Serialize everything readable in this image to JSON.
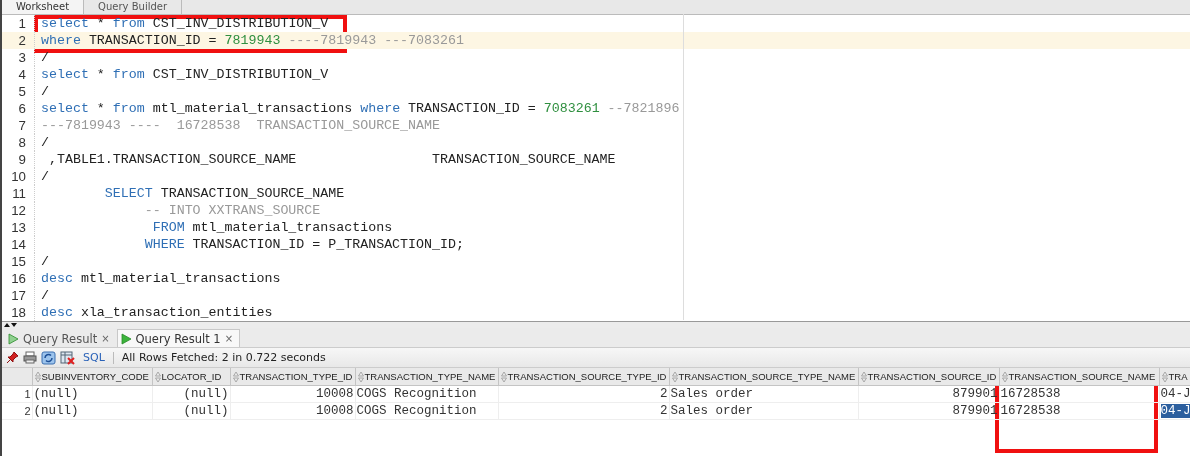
{
  "top_tabs": [
    {
      "label": "Worksheet",
      "selected": true
    },
    {
      "label": "Query Builder",
      "selected": false
    }
  ],
  "editor": {
    "lines": [
      {
        "number": "1",
        "tokens": [
          {
            "kind": "kw",
            "text": "select"
          },
          {
            "kind": "plain",
            "text": " * "
          },
          {
            "kind": "kw",
            "text": "from"
          },
          {
            "kind": "plain",
            "text": " CST_INV_DISTRIBUTION_V"
          }
        ]
      },
      {
        "number": "2",
        "current": true,
        "tokens": [
          {
            "kind": "kw",
            "text": "where"
          },
          {
            "kind": "plain",
            "text": " TRANSACTION_ID = "
          },
          {
            "kind": "num",
            "text": "7819943"
          },
          {
            "kind": "comment",
            "text": " ----7819943 ---7083261"
          }
        ]
      },
      {
        "number": "3",
        "tokens": [
          {
            "kind": "plain",
            "text": "/"
          }
        ]
      },
      {
        "number": "4",
        "tokens": [
          {
            "kind": "kw",
            "text": "select"
          },
          {
            "kind": "plain",
            "text": " * "
          },
          {
            "kind": "kw",
            "text": "from"
          },
          {
            "kind": "plain",
            "text": " CST_INV_DISTRIBUTION_V"
          }
        ]
      },
      {
        "number": "5",
        "tokens": [
          {
            "kind": "plain",
            "text": "/"
          }
        ]
      },
      {
        "number": "6",
        "tokens": [
          {
            "kind": "kw",
            "text": "select"
          },
          {
            "kind": "plain",
            "text": " * "
          },
          {
            "kind": "kw",
            "text": "from"
          },
          {
            "kind": "plain",
            "text": " mtl_material_transactions "
          },
          {
            "kind": "kw",
            "text": "where"
          },
          {
            "kind": "plain",
            "text": " TRANSACTION_ID = "
          },
          {
            "kind": "num",
            "text": "7083261"
          },
          {
            "kind": "comment",
            "text": " --7821896"
          }
        ]
      },
      {
        "number": "7",
        "tokens": [
          {
            "kind": "comment",
            "text": "---7819943 ----  16728538  TRANSACTION_SOURCE_NAME"
          }
        ]
      },
      {
        "number": "8",
        "tokens": [
          {
            "kind": "plain",
            "text": "/"
          }
        ]
      },
      {
        "number": "9",
        "tokens": [
          {
            "kind": "plain",
            "text": " ,TABLE1.TRANSACTION_SOURCE_NAME                 TRANSACTION_SOURCE_NAME"
          }
        ]
      },
      {
        "number": "10",
        "tokens": [
          {
            "kind": "plain",
            "text": "/"
          }
        ]
      },
      {
        "number": "11",
        "tokens": [
          {
            "kind": "kw",
            "text": "        SELECT"
          },
          {
            "kind": "plain",
            "text": " TRANSACTION_SOURCE_NAME"
          }
        ]
      },
      {
        "number": "12",
        "tokens": [
          {
            "kind": "comment",
            "text": "             -- INTO XXTRANS_SOURCE"
          }
        ]
      },
      {
        "number": "13",
        "tokens": [
          {
            "kind": "kw",
            "text": "              FROM"
          },
          {
            "kind": "plain",
            "text": " mtl_material_transactions"
          }
        ]
      },
      {
        "number": "14",
        "tokens": [
          {
            "kind": "kw",
            "text": "             WHERE"
          },
          {
            "kind": "plain",
            "text": " TRANSACTION_ID = P_TRANSACTION_ID;"
          }
        ]
      },
      {
        "number": "15",
        "tokens": [
          {
            "kind": "plain",
            "text": "/"
          }
        ]
      },
      {
        "number": "16",
        "tokens": [
          {
            "kind": "kw",
            "text": "desc"
          },
          {
            "kind": "plain",
            "text": " mtl_material_transactions"
          }
        ]
      },
      {
        "number": "17",
        "tokens": [
          {
            "kind": "plain",
            "text": "/"
          }
        ]
      },
      {
        "number": "18",
        "tokens": [
          {
            "kind": "kw",
            "text": "desc"
          },
          {
            "kind": "plain",
            "text": " xla_transaction_entities"
          }
        ]
      }
    ]
  },
  "result_tabs": [
    {
      "label": "Query Result",
      "close": "×",
      "selected": false
    },
    {
      "label": "Query Result 1",
      "close": "×",
      "selected": true
    }
  ],
  "toolbar": {
    "sql_link": "SQL",
    "status": "All Rows Fetched: 2 in 0.722 seconds"
  },
  "grid": {
    "columns": [
      {
        "label": "SUBINVENTORY_CODE",
        "kind": "text"
      },
      {
        "label": "LOCATOR_ID",
        "kind": "number"
      },
      {
        "label": "TRANSACTION_TYPE_ID",
        "kind": "number"
      },
      {
        "label": "TRANSACTION_TYPE_NAME",
        "kind": "text"
      },
      {
        "label": "TRANSACTION_SOURCE_TYPE_ID",
        "kind": "number"
      },
      {
        "label": "TRANSACTION_SOURCE_TYPE_NAME",
        "kind": "text"
      },
      {
        "label": "TRANSACTION_SOURCE_ID",
        "kind": "number"
      },
      {
        "label": "TRANSACTION_SOURCE_NAME",
        "kind": "text"
      },
      {
        "label": "TRA",
        "kind": "text"
      }
    ],
    "rows": [
      {
        "number": "1",
        "cells": [
          {
            "text": "(null)",
            "selected": false
          },
          {
            "text": "(null)",
            "selected": false
          },
          {
            "text": "10008",
            "selected": false
          },
          {
            "text": "COGS Recognition",
            "selected": false
          },
          {
            "text": "2",
            "selected": false
          },
          {
            "text": "Sales order",
            "selected": false
          },
          {
            "text": "879901",
            "selected": false
          },
          {
            "text": "16728538",
            "selected": false
          },
          {
            "text": "04-J",
            "selected": false
          }
        ]
      },
      {
        "number": "2",
        "cells": [
          {
            "text": "(null)",
            "selected": false
          },
          {
            "text": "(null)",
            "selected": false
          },
          {
            "text": "10008",
            "selected": false
          },
          {
            "text": "COGS Recognition",
            "selected": false
          },
          {
            "text": "2",
            "selected": false
          },
          {
            "text": "Sales order",
            "selected": false
          },
          {
            "text": "879901",
            "selected": false
          },
          {
            "text": "16728538",
            "selected": false
          },
          {
            "text": "04-J",
            "selected": true
          }
        ]
      }
    ]
  }
}
